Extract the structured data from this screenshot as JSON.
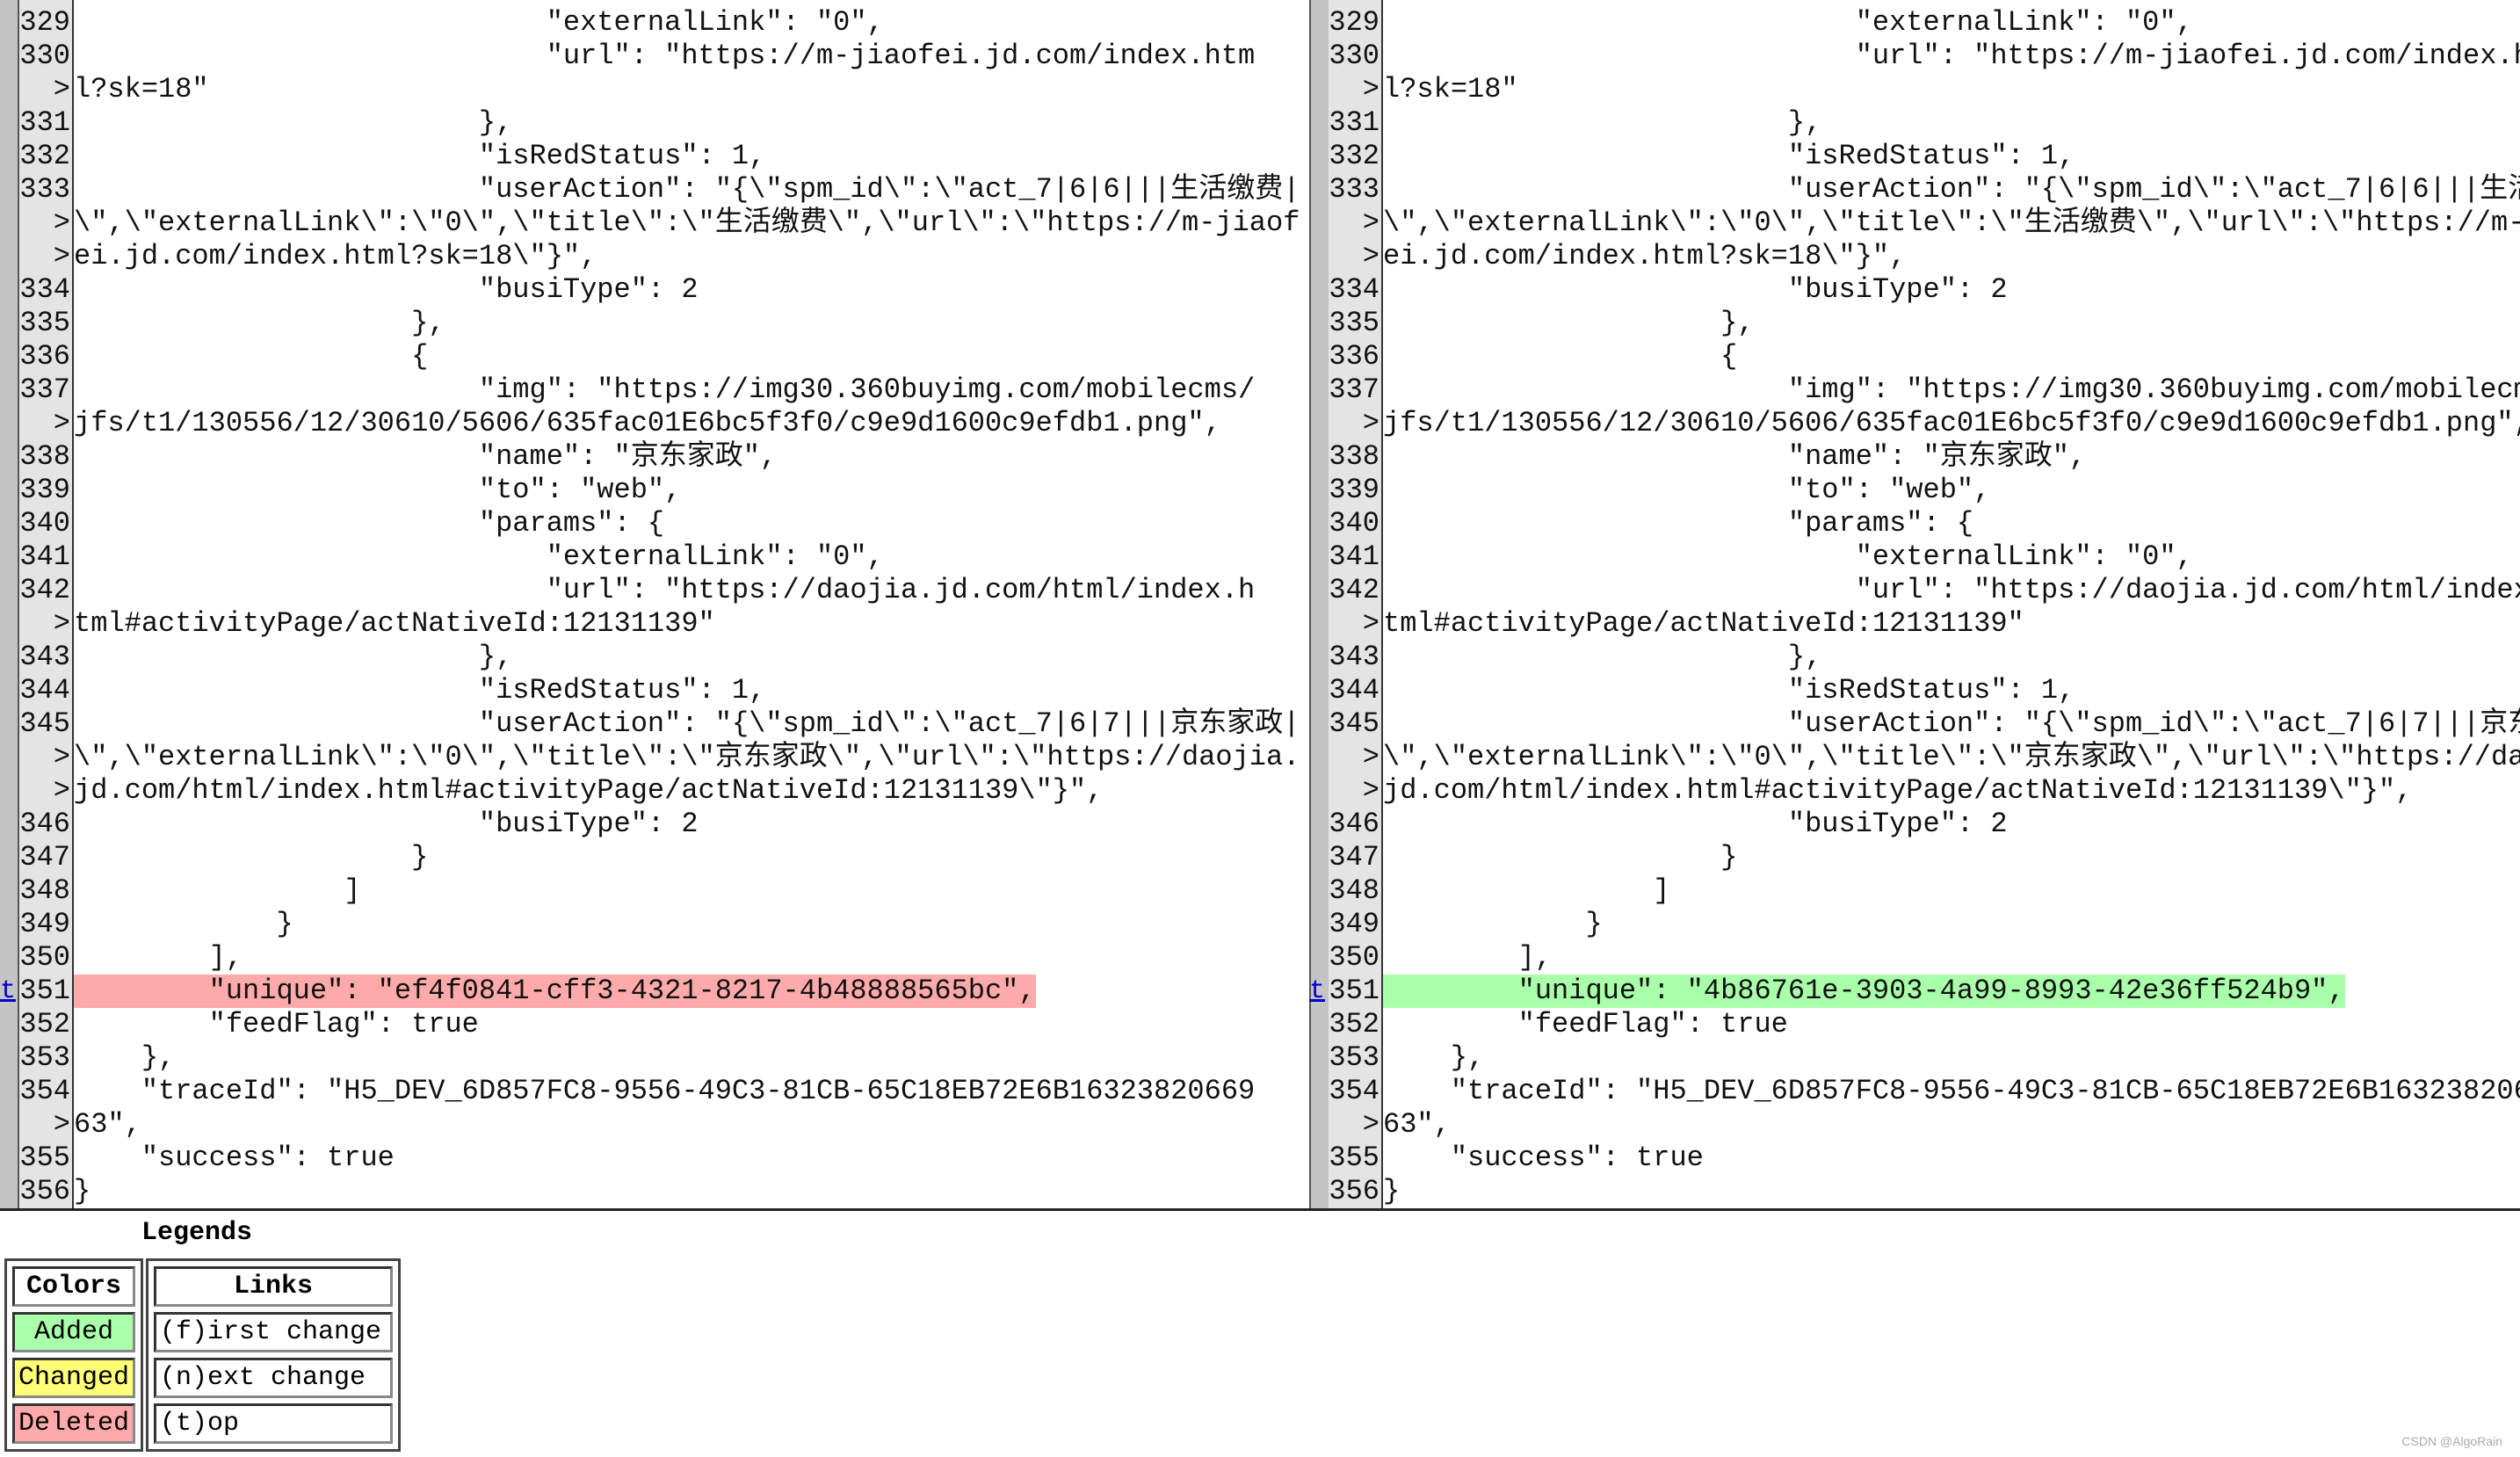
{
  "colors": {
    "added": "#aaffaa",
    "changed": "#ffff77",
    "deleted": "#ffaaaa",
    "link": "#0000cc"
  },
  "diff": {
    "change_marker": "t",
    "rows": [
      {
        "num": "329",
        "text": "                            \"externalLink\": \"0\","
      },
      {
        "num": "330",
        "text": "                            \"url\": \"https://m-jiaofei.jd.com/index.htm"
      },
      {
        "num": ">",
        "text": "l?sk=18\""
      },
      {
        "num": "331",
        "text": "                        },"
      },
      {
        "num": "332",
        "text": "                        \"isRedStatus\": 1,"
      },
      {
        "num": "333",
        "text": "                        \"userAction\": \"{\\\"spm_id\\\":\\\"act_7|6|6|||生活缴费|"
      },
      {
        "num": ">",
        "text": "\\\",\\\"externalLink\\\":\\\"0\\\",\\\"title\\\":\\\"生活缴费\\\",\\\"url\\\":\\\"https://m-jiaof"
      },
      {
        "num": ">",
        "text": "ei.jd.com/index.html?sk=18\\\"}\","
      },
      {
        "num": "334",
        "text": "                        \"busiType\": 2"
      },
      {
        "num": "335",
        "text": "                    },"
      },
      {
        "num": "336",
        "text": "                    {"
      },
      {
        "num": "337",
        "text": "                        \"img\": \"https://img30.360buyimg.com/mobilecms/"
      },
      {
        "num": ">",
        "text": "jfs/t1/130556/12/30610/5606/635fac01E6bc5f3f0/c9e9d1600c9efdb1.png\","
      },
      {
        "num": "338",
        "text": "                        \"name\": \"京东家政\","
      },
      {
        "num": "339",
        "text": "                        \"to\": \"web\","
      },
      {
        "num": "340",
        "text": "                        \"params\": {"
      },
      {
        "num": "341",
        "text": "                            \"externalLink\": \"0\","
      },
      {
        "num": "342",
        "text": "                            \"url\": \"https://daojia.jd.com/html/index.h"
      },
      {
        "num": ">",
        "text": "tml#activityPage/actNativeId:12131139\""
      },
      {
        "num": "343",
        "text": "                        },"
      },
      {
        "num": "344",
        "text": "                        \"isRedStatus\": 1,"
      },
      {
        "num": "345",
        "text": "                        \"userAction\": \"{\\\"spm_id\\\":\\\"act_7|6|7|||京东家政|"
      },
      {
        "num": ">",
        "text": "\\\",\\\"externalLink\\\":\\\"0\\\",\\\"title\\\":\\\"京东家政\\\",\\\"url\\\":\\\"https://daojia."
      },
      {
        "num": ">",
        "text": "jd.com/html/index.html#activityPage/actNativeId:12131139\\\"}\","
      },
      {
        "num": "346",
        "text": "                        \"busiType\": 2"
      },
      {
        "num": "347",
        "text": "                    }"
      },
      {
        "num": "348",
        "text": "                ]"
      },
      {
        "num": "349",
        "text": "            }"
      },
      {
        "num": "350",
        "text": "        ],"
      },
      {
        "num": "351",
        "changed": true,
        "left_text": "        \"unique\": \"ef4f0841-cff3-4321-8217-4b48888565bc\",",
        "right_text": "        \"unique\": \"4b86761e-3903-4a99-8993-42e36ff524b9\","
      },
      {
        "num": "352",
        "text": "        \"feedFlag\": true"
      },
      {
        "num": "353",
        "text": "    },"
      },
      {
        "num": "354",
        "text": "    \"traceId\": \"H5_DEV_6D857FC8-9556-49C3-81CB-65C18EB72E6B16323820669"
      },
      {
        "num": ">",
        "text": "63\","
      },
      {
        "num": "355",
        "text": "    \"success\": true"
      },
      {
        "num": "356",
        "text": "}"
      }
    ]
  },
  "legend": {
    "title": "Legends",
    "colors_header": "Colors",
    "added": "Added",
    "changed": "Changed",
    "deleted": "Deleted",
    "links_header": "Links",
    "first_change": "(f)irst change",
    "next_change": "(n)ext change",
    "top": "(t)op"
  },
  "watermark": "CSDN @AlgoRain"
}
